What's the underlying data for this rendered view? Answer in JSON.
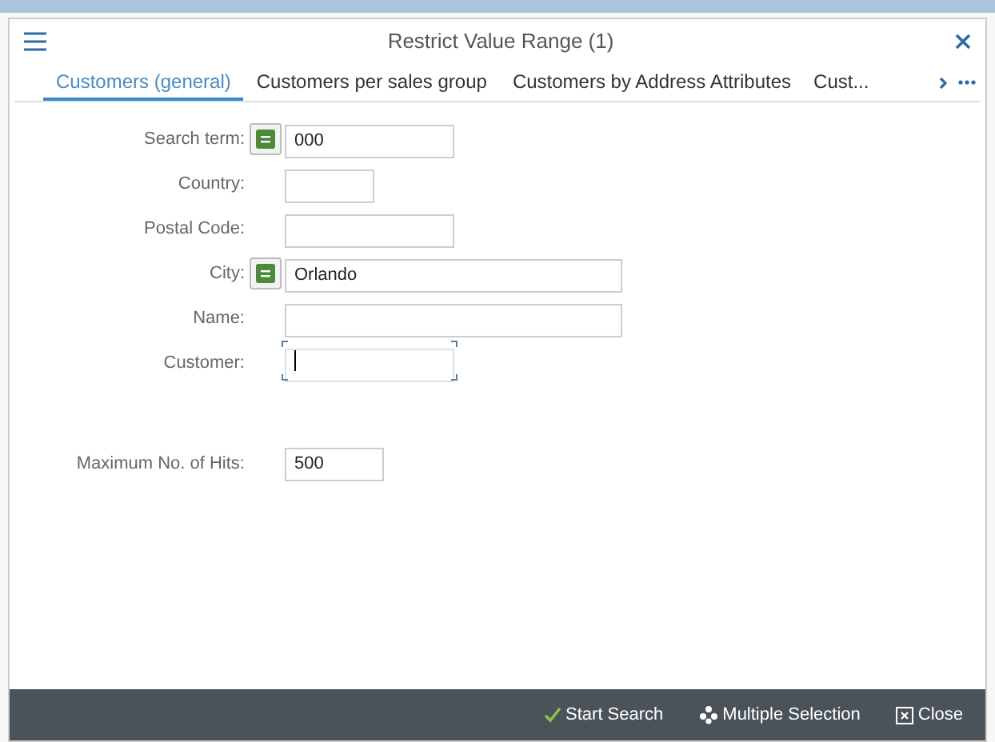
{
  "dialog": {
    "title": "Restrict Value Range (1)"
  },
  "tabs": [
    {
      "label": "Customers (general)",
      "selected": true
    },
    {
      "label": "Customers per sales group",
      "selected": false
    },
    {
      "label": "Customers by Address Attributes",
      "selected": false
    },
    {
      "label": "Cust...",
      "selected": false
    }
  ],
  "fields": [
    {
      "label": "Search term:",
      "value": "000",
      "operator": true,
      "focused": false
    },
    {
      "label": "Country:",
      "operator": false,
      "focused": false
    },
    {
      "label": "Postal Code:",
      "operator": false,
      "focused": false
    },
    {
      "label": "City:",
      "value": "Orlando",
      "operator": true,
      "focused": false
    },
    {
      "label": "Name:",
      "operator": false,
      "focused": false
    },
    {
      "label": "Customer:",
      "operator": false,
      "focused": true
    }
  ],
  "max_hits": {
    "label": "Maximum No. of Hits:",
    "value": "500"
  },
  "footer_buttons": [
    {
      "kind": "search",
      "label": "Start Search"
    },
    {
      "kind": "multiple",
      "label": "Multiple Selection"
    },
    {
      "kind": "close",
      "label": "Close"
    }
  ]
}
